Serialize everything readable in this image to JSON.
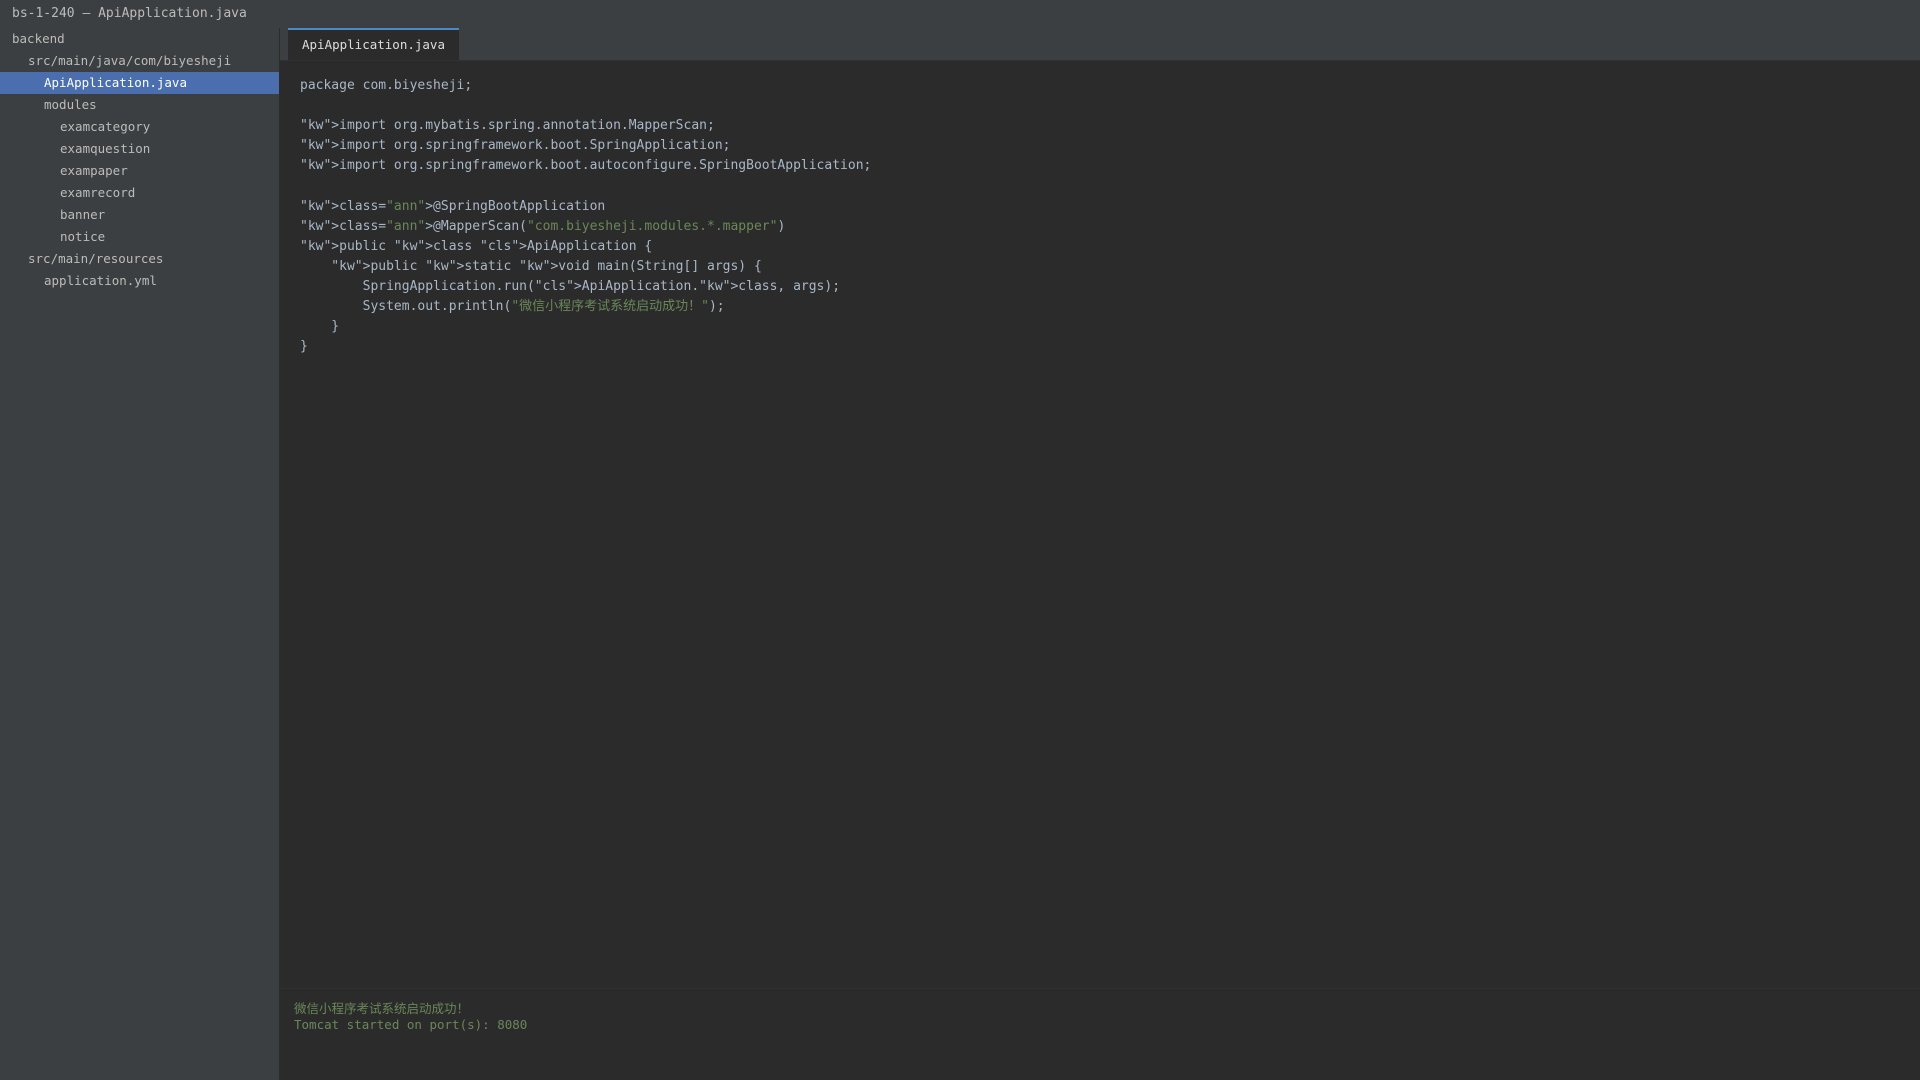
{
  "window": {
    "title": "bs-1-240 — ApiApplication.java"
  },
  "sidebar": {
    "items": [
      {
        "label": "backend",
        "level": 0,
        "selected": false
      },
      {
        "label": "src/main/java/com/biyesheji",
        "level": 1,
        "selected": false
      },
      {
        "label": "ApiApplication.java",
        "level": 2,
        "selected": true
      },
      {
        "label": "modules",
        "level": 2,
        "selected": false
      },
      {
        "label": "examcategory",
        "level": 3,
        "selected": false
      },
      {
        "label": "examquestion",
        "level": 3,
        "selected": false
      },
      {
        "label": "exampaper",
        "level": 3,
        "selected": false
      },
      {
        "label": "examrecord",
        "level": 3,
        "selected": false
      },
      {
        "label": "banner",
        "level": 3,
        "selected": false
      },
      {
        "label": "notice",
        "level": 3,
        "selected": false
      },
      {
        "label": "src/main/resources",
        "level": 1,
        "selected": false
      },
      {
        "label": "application.yml",
        "level": 2,
        "selected": false
      }
    ]
  },
  "editor": {
    "tab_label": "ApiApplication.java",
    "lines": [
      [
        {
          "t": "package com.biyesheji;"
        }
      ],
      [],
      [
        {
          "t": "\"kw\">import org.mybatis.spring.annotation.MapperScan;"
        }
      ],
      [
        {
          "t": "\"kw\">import org.springframework.boot.SpringApplication;"
        }
      ],
      [
        {
          "t": "\"kw\">import org.springframework.boot.autoconfigure.SpringBootApplication;"
        }
      ],
      [],
      [
        {
          "t": "\"kw\">class="
        },
        {
          "t": "\"ann\"",
          "c": "str"
        },
        {
          "t": ">@SpringBootApplication"
        }
      ],
      [
        {
          "t": "\"kw\">class="
        },
        {
          "t": "\"ann\"",
          "c": "str"
        },
        {
          "t": ">@MapperScan("
        },
        {
          "t": "\"com.biyesheji.modules.*.mapper\"",
          "c": "str"
        },
        {
          "t": ")"
        }
      ],
      [
        {
          "t": "\"kw\">public \"kw\">class \"cls\">ApiApplication {"
        }
      ],
      [
        {
          "t": "    \"kw\">public \"kw\">static \"kw\">void main(String[] args) {"
        }
      ],
      [
        {
          "t": "        SpringApplication.run(\"cls\">ApiApplication.\"kw\">class, args);"
        }
      ],
      [
        {
          "t": "        System.out.println("
        },
        {
          "t": "\"微信小程序考试系统启动成功！\"",
          "c": "str"
        },
        {
          "t": ");"
        }
      ],
      [
        {
          "t": "    }"
        }
      ],
      [
        {
          "t": "}"
        }
      ]
    ]
  },
  "console": {
    "lines": [
      "微信小程序考试系统启动成功！",
      "Tomcat started on port(s): 8080"
    ]
  },
  "colors": {
    "background": "#2b2b2b",
    "panel": "#3c3f41",
    "selection": "#4b6eaf",
    "string": "#6a8759",
    "text": "#a9b7c6"
  }
}
